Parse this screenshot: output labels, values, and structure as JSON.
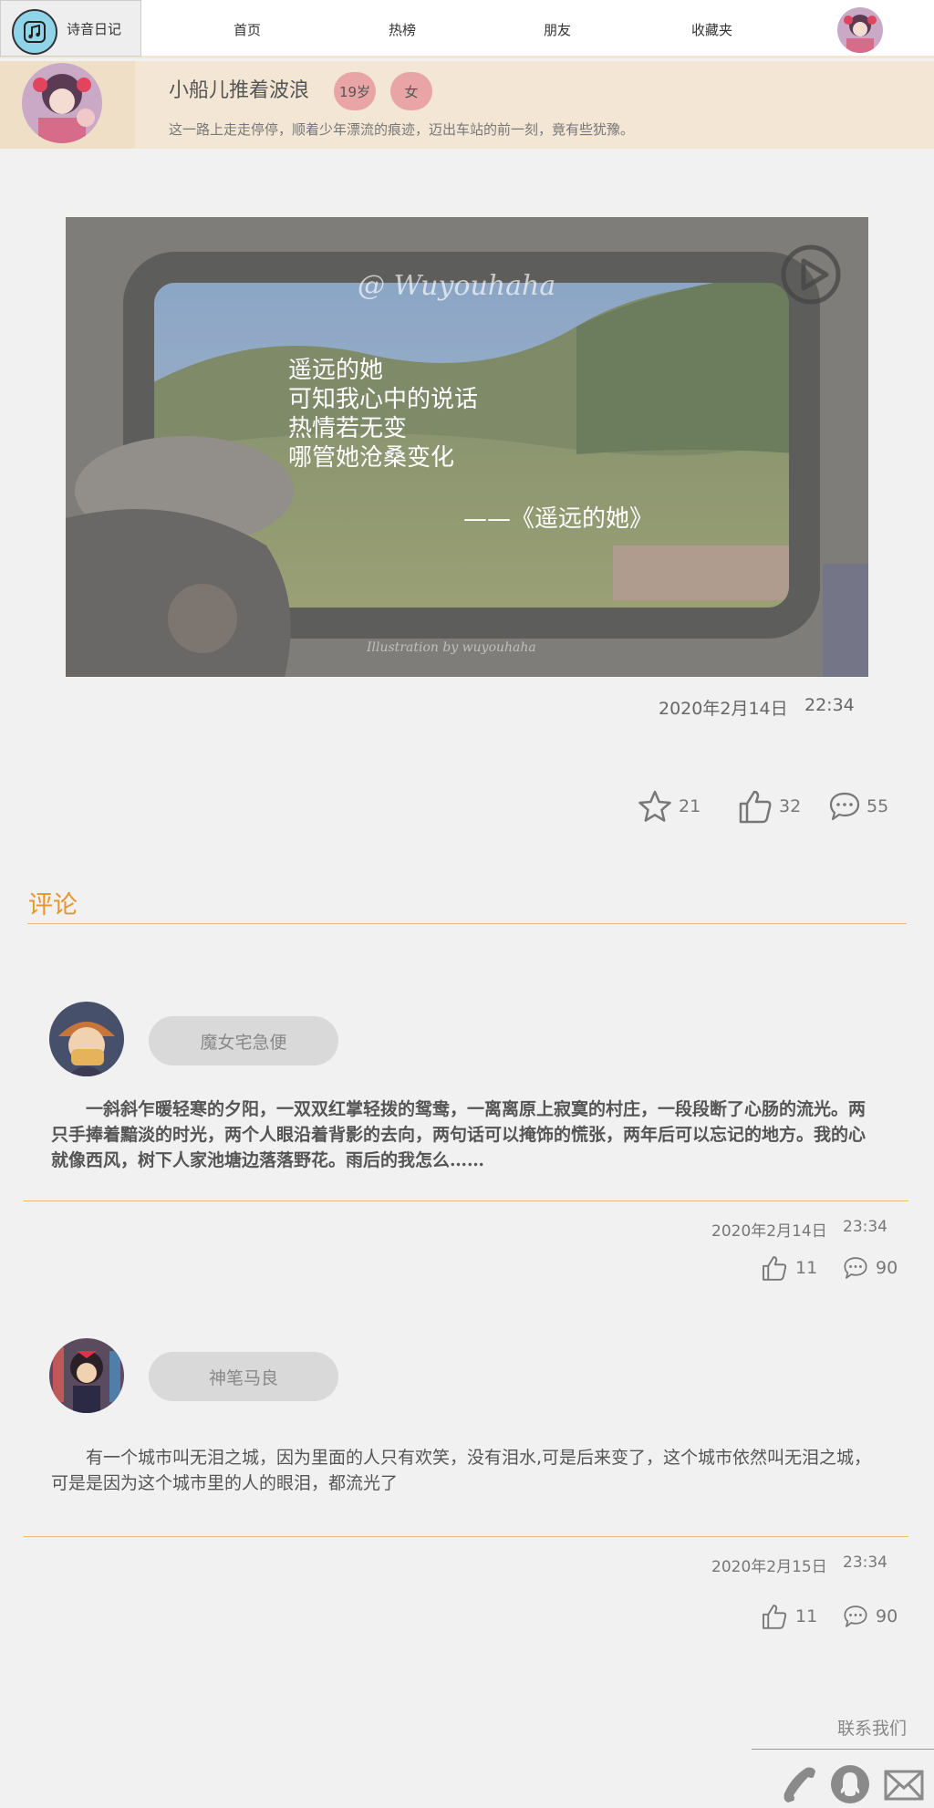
{
  "app": {
    "name": "诗音日记"
  },
  "nav": {
    "items": [
      "首页",
      "热榜",
      "朋友",
      "收藏夹"
    ]
  },
  "profile": {
    "name": "小船儿推着波浪",
    "age": "19岁",
    "gender": "女",
    "bio": "这一路上走走停停，顺着少年漂流的痕迹，迈出车站的前一刻，竟有些犹豫。"
  },
  "post": {
    "poem_lines": [
      "遥远的她",
      "可知我心中的说话",
      "热情若无变",
      "哪管她沧桑变化"
    ],
    "poem_source": "——《遥远的她》",
    "watermark_top": "@ Wuyouhaha",
    "watermark_bottom": "Illustration by wuyouhaha",
    "date": "2020年2月14日",
    "time": "22:34",
    "favorites": "21",
    "likes": "32",
    "comments": "55"
  },
  "comments_section": {
    "title": "评论",
    "items": [
      {
        "user": "魔女宅急便",
        "text": "一斜斜乍暖轻寒的夕阳，一双双红掌轻拨的鸳鸯，一离离原上寂寞的村庄，一段段断了心肠的流光。两只手捧着黯淡的时光，两个人眼沿着背影的去向，两句话可以掩饰的慌张，两年后可以忘记的地方。我的心就像西风，树下人家池塘边落落野花。雨后的我怎么……",
        "date": "2020年2月14日",
        "time": "23:34",
        "likes": "11",
        "replies": "90"
      },
      {
        "user": "神笔马良",
        "text": "有一个城市叫无泪之城，因为里面的人只有欢笑，没有泪水,可是后来变了，这个城市依然叫无泪之城，可是是因为这个城市里的人的眼泪，都流光了",
        "date": "2020年2月15日",
        "time": "23:34",
        "likes": "11",
        "replies": "90"
      }
    ]
  },
  "footer": {
    "contact_label": "联系我们"
  },
  "colors": {
    "accent": "#e8952b",
    "profile_bg": "#f3e6d4",
    "pill": "#e9a5a5"
  }
}
